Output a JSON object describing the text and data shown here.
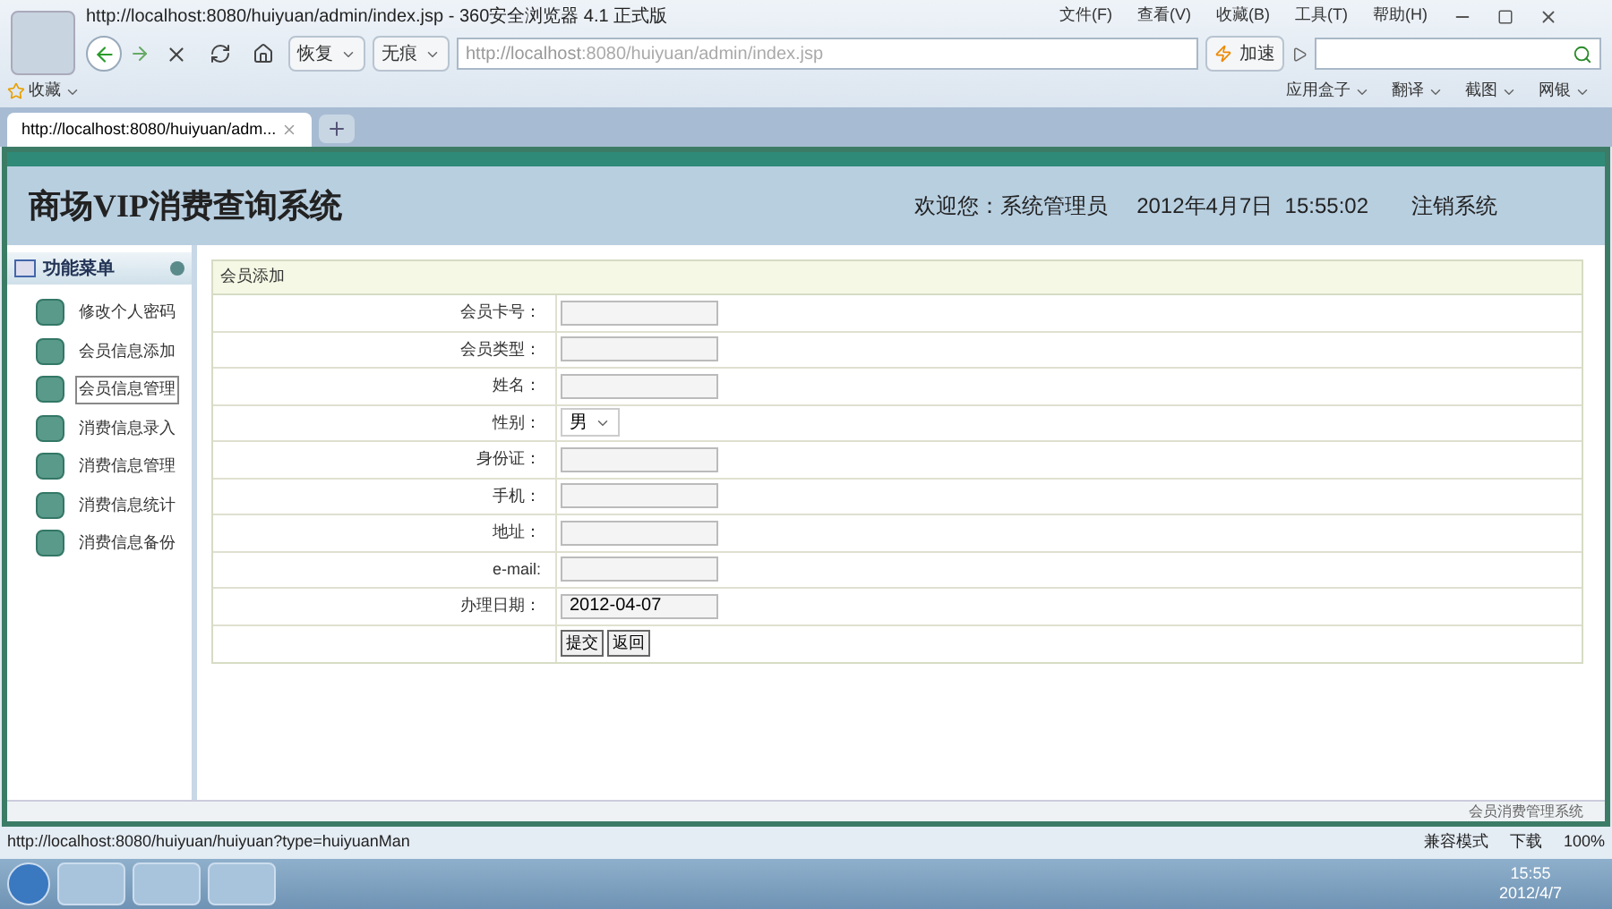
{
  "browser": {
    "title": "http://localhost:8080/huiyuan/admin/index.jsp - 360安全浏览器 4.1 正式版",
    "menu": [
      "文件(F)",
      "查看(V)",
      "收藏(B)",
      "工具(T)",
      "帮助(H)"
    ],
    "nav_buttons": [
      "恢复",
      "无痕"
    ],
    "address": {
      "host": "http://localhost",
      "rest": ":8080/huiyuan/admin/index.jsp"
    },
    "speedup": "加速",
    "favorites": "收藏",
    "toolbar": [
      "应用盒子",
      "翻译",
      "截图",
      "网银"
    ],
    "tabs": [
      {
        "label": "http://localhost:8080/huiyuan/adm...",
        "selected": true
      }
    ],
    "status_url": "http://localhost:8080/huiyuan/huiyuan?type=huiyuanMan",
    "status_items": [
      "兼容模式",
      "下载",
      "100%"
    ]
  },
  "app": {
    "title": "商场VIP消费查询系统",
    "welcome": "欢迎您：系统管理员",
    "datetime": "2012年4月7日  15:55:02",
    "logout": "注销系统",
    "menu_title": "功能菜单",
    "menu": [
      {
        "label": "修改个人密码",
        "selected": false
      },
      {
        "label": "会员信息添加",
        "selected": false
      },
      {
        "label": "会员信息管理",
        "selected": true
      },
      {
        "label": "消费信息录入",
        "selected": false
      },
      {
        "label": "消费信息管理",
        "selected": false
      },
      {
        "label": "消费信息统计",
        "selected": false
      },
      {
        "label": "消费信息备份",
        "selected": false
      }
    ],
    "panel_title": "会员添加",
    "fields": [
      {
        "label": "会员卡号：",
        "kind": "input"
      },
      {
        "label": "会员类型：",
        "kind": "input"
      },
      {
        "label": "姓名：",
        "kind": "input"
      },
      {
        "label": "性别：",
        "kind": "select",
        "value": "男"
      },
      {
        "label": "身份证：",
        "kind": "input"
      },
      {
        "label": "手机：",
        "kind": "input"
      },
      {
        "label": "地址：",
        "kind": "input"
      },
      {
        "label": "e-mail:",
        "kind": "input"
      },
      {
        "label": "办理日期：",
        "kind": "input",
        "value": "2012-04-07"
      }
    ],
    "buttons": [
      "提交",
      "返回"
    ],
    "footer": "会员消费管理系统"
  },
  "taskbar": {
    "time": "15:55",
    "date": "2012/4/7"
  }
}
